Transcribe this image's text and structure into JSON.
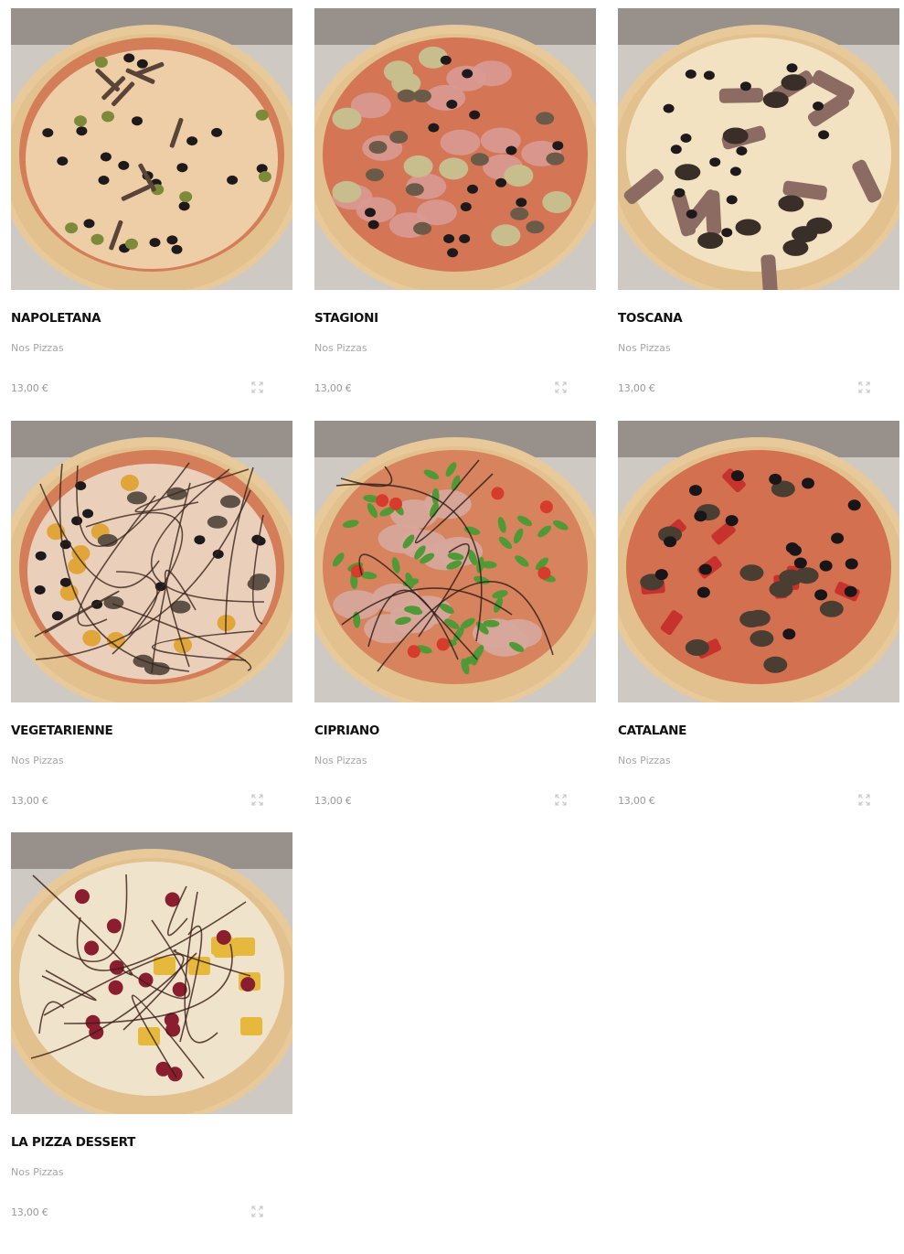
{
  "products": [
    {
      "name": "NAPOLETANA",
      "category": "Nos Pizzas",
      "price": "13,00 €",
      "image": "pizza-napoletana",
      "topping": "anchovy-olive",
      "quick_view_icon": "expand-icon"
    },
    {
      "name": "STAGIONI",
      "category": "Nos Pizzas",
      "price": "13,00 €",
      "image": "pizza-stagioni",
      "topping": "ham-artichoke-mushroom",
      "quick_view_icon": "expand-icon"
    },
    {
      "name": "TOSCANA",
      "category": "Nos Pizzas",
      "price": "13,00 €",
      "image": "pizza-toscana",
      "topping": "bacon-eggplant",
      "quick_view_icon": "expand-icon"
    },
    {
      "name": "VEGETARIENNE",
      "category": "Nos Pizzas",
      "price": "13,00 €",
      "image": "pizza-vegetarienne",
      "topping": "vegetables-balsamic",
      "quick_view_icon": "expand-icon"
    },
    {
      "name": "CIPRIANO",
      "category": "Nos Pizzas",
      "price": "13,00 €",
      "image": "pizza-cipriano",
      "topping": "arugula-prosciutto",
      "quick_view_icon": "expand-icon"
    },
    {
      "name": "CATALANE",
      "category": "Nos Pizzas",
      "price": "13,00 €",
      "image": "pizza-catalane",
      "topping": "pepper-olive-mushroom",
      "quick_view_icon": "expand-icon"
    },
    {
      "name": "LA PIZZA DESSERT",
      "category": "Nos Pizzas",
      "price": "13,00 €",
      "image": "pizza-dessert",
      "topping": "fruit-chocolate",
      "quick_view_icon": "expand-icon"
    }
  ],
  "colors": {
    "title": "#111111",
    "category": "#a7a7a7",
    "price": "#9a9a9a",
    "crust": "#e8c99a",
    "sauce": "#c9452e",
    "cheese": "#f1dcb4"
  }
}
